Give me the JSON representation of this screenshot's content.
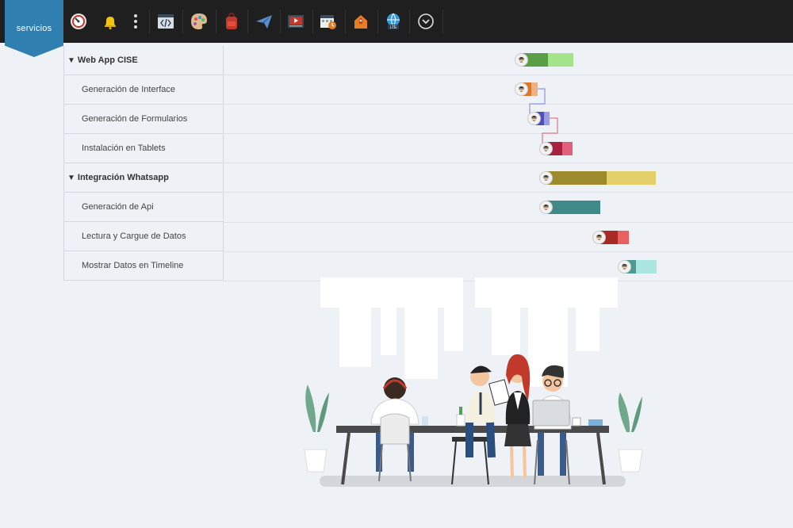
{
  "brand": {
    "logo_text": "servicios",
    "color": "#2f7fb0"
  },
  "toolbar": {
    "icons": [
      "dashboard-gauge-icon",
      "notification-bell-icon",
      "more-vertical-icon",
      "code-editor-icon",
      "palette-icon",
      "backpack-icon",
      "paper-plane-icon",
      "video-player-icon",
      "calendar-icon",
      "rocket-house-icon",
      "globe-lte-icon",
      "chevron-down-circle-icon"
    ]
  },
  "tasks": [
    {
      "label": "Web App CISE",
      "type": "group",
      "progress": 0.5,
      "colors": [
        "#5a9e45",
        "#a3e38a"
      ]
    },
    {
      "label": "Generación de Interface",
      "type": "task",
      "progress": 0.6,
      "colors": [
        "#d9772b",
        "#f0b07d"
      ]
    },
    {
      "label": "Generación de Formularios",
      "type": "task",
      "progress": 0.6,
      "colors": [
        "#4f4fb8",
        "#9a9ae5"
      ]
    },
    {
      "label": "Instalación en Tablets",
      "type": "task",
      "progress": 0.6,
      "colors": [
        "#a8213f",
        "#e2607b"
      ]
    },
    {
      "label": "Integración Whatsapp",
      "type": "group",
      "progress": 0.55,
      "colors": [
        "#9c8a2d",
        "#e3d06a"
      ]
    },
    {
      "label": "Generación de Api",
      "type": "task",
      "progress": 1.0,
      "colors": [
        "#3f8a88",
        "#9fd6d4"
      ]
    },
    {
      "label": "Lectura y Cargue de Datos",
      "type": "task",
      "progress": 0.6,
      "colors": [
        "#a82a25",
        "#e86060"
      ]
    },
    {
      "label": "Mostrar Datos en Timeline",
      "type": "task",
      "progress": 0.35,
      "colors": [
        "#4d9a92",
        "#a8e6df"
      ]
    }
  ]
}
